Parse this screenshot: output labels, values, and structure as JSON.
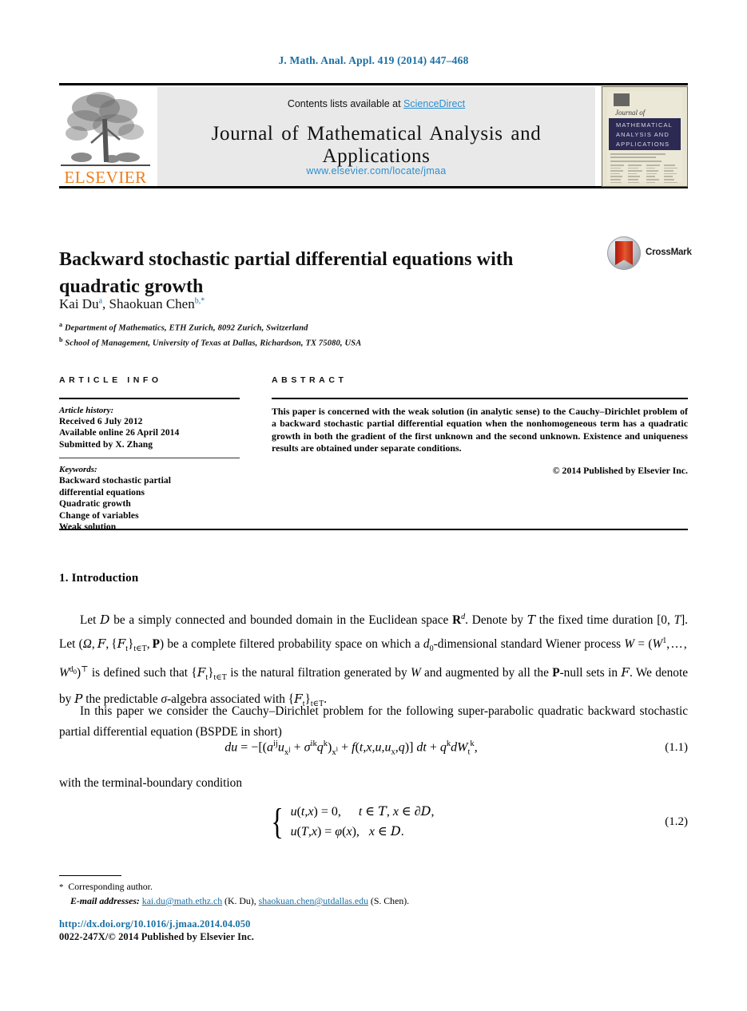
{
  "running_head": "J. Math. Anal. Appl. 419 (2014) 447–468",
  "masthead": {
    "contents_prefix": "Contents lists available at ",
    "sciencedirect": "ScienceDirect",
    "journal_title": "Journal of Mathematical Analysis and Applications",
    "journal_url": "www.elsevier.com/locate/jmaa",
    "publisher_wordmark": "ELSEVIER",
    "cover": {
      "script_line": "Journal of",
      "band_line_1": "MATHEMATICAL",
      "band_line_2": "ANALYSIS AND",
      "band_line_3": "APPLICATIONS"
    }
  },
  "article": {
    "title": "Backward stochastic partial differential equations with quadratic growth",
    "crossmark_label": "CrossMark",
    "authors_plain": "Kai Du",
    "author_1": "Kai Du",
    "author_1_sup": "a",
    "author_2": "Shaokuan Chen",
    "author_2_sup": "b,*",
    "affiliation_a_sup": "a",
    "affiliation_a": "Department of Mathematics, ETH Zurich, 8092 Zurich, Switzerland",
    "affiliation_b_sup": "b",
    "affiliation_b": "School of Management, University of Texas at Dallas, Richardson, TX 75080, USA"
  },
  "article_info": {
    "heading": "ARTICLE INFO",
    "history_label": "Article history:",
    "received": "Received 6 July 2012",
    "available_online": "Available online 26 April 2014",
    "submitted_by": "Submitted by X. Zhang",
    "keywords_label": "Keywords:",
    "keywords": [
      "Backward stochastic partial",
      "differential equations",
      "Quadratic growth",
      "Change of variables",
      "Weak solution"
    ]
  },
  "abstract": {
    "heading": "ABSTRACT",
    "body": "This paper is concerned with the weak solution (in analytic sense) to the Cauchy–Dirichlet problem of a backward stochastic partial differential equation when the nonhomogeneous term has a quadratic growth in both the gradient of the first unknown and the second unknown. Existence and uniqueness results are obtained under separate conditions.",
    "copyright": "© 2014 Published by Elsevier Inc."
  },
  "body": {
    "section_1_title": "1. Introduction",
    "paragraph_2_text": "In this paper we consider the Cauchy–Dirichlet problem for the following super-parabolic quadratic backward stochastic partial differential equation (BSPDE in short)",
    "paragraph_3_text": "with the terminal-boundary condition",
    "equation_1_number": "(1.1)",
    "equation_2_number": "(1.2)"
  },
  "footnotes": {
    "corresponding_author": "Corresponding author.",
    "email_label": "E-mail addresses:",
    "email_1": "kai.du@math.ethz.ch",
    "email_1_owner": "(K. Du),",
    "email_2": "shaokuan.chen@utdallas.edu",
    "email_2_owner": "(S. Chen).",
    "doi": "http://dx.doi.org/10.1016/j.jmaa.2014.04.050",
    "issn_line": "0022-247X/© 2014 Published by Elsevier Inc."
  },
  "colors": {
    "link_blue": "#1a6fa3",
    "sciencedirect_blue": "#2b8fd0",
    "elsevier_orange": "#ef7c19",
    "cover_band_navy": "#2c2a53",
    "masthead_grey": "#e9e9e9"
  }
}
